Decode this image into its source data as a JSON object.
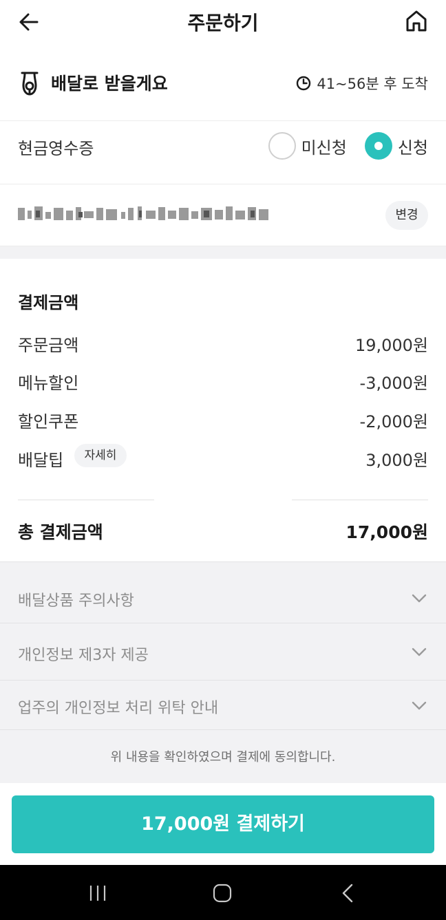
{
  "header": {
    "title": "주문하기",
    "back_icon": "arrow-left-icon",
    "home_icon": "home-icon"
  },
  "delivery": {
    "icon": "scooter-icon",
    "label": "배달로 받을게요",
    "eta": "41~56분 후 도착",
    "eta_icon": "clock-icon"
  },
  "cash_receipt": {
    "label": "현금영수증",
    "options": [
      {
        "label": "미신청",
        "selected": false
      },
      {
        "label": "신청",
        "selected": true
      }
    ]
  },
  "address": {
    "change_label": "변경"
  },
  "payment": {
    "title": "결제금액",
    "rows": [
      {
        "label": "주문금액",
        "value": "19,000원"
      },
      {
        "label": "메뉴할인",
        "value": "-3,000원"
      },
      {
        "label": "할인쿠폰",
        "value": "-2,000원"
      },
      {
        "label": "배달팁",
        "value": "3,000원",
        "detail_label": "자세히"
      }
    ],
    "total_label": "총 결제금액",
    "total_value": "17,000원"
  },
  "notices": [
    {
      "label": "배달상품 주의사항"
    },
    {
      "label": "개인정보 제3자 제공"
    },
    {
      "label": "업주의 개인정보 처리 위탁 안내"
    }
  ],
  "agreement_text": "위 내용을 확인하였으며 결제에 동의합니다.",
  "pay_button": "17,000원 결제하기",
  "colors": {
    "accent": "#2ac1bc",
    "notice_bg": "#f2f2f4"
  }
}
